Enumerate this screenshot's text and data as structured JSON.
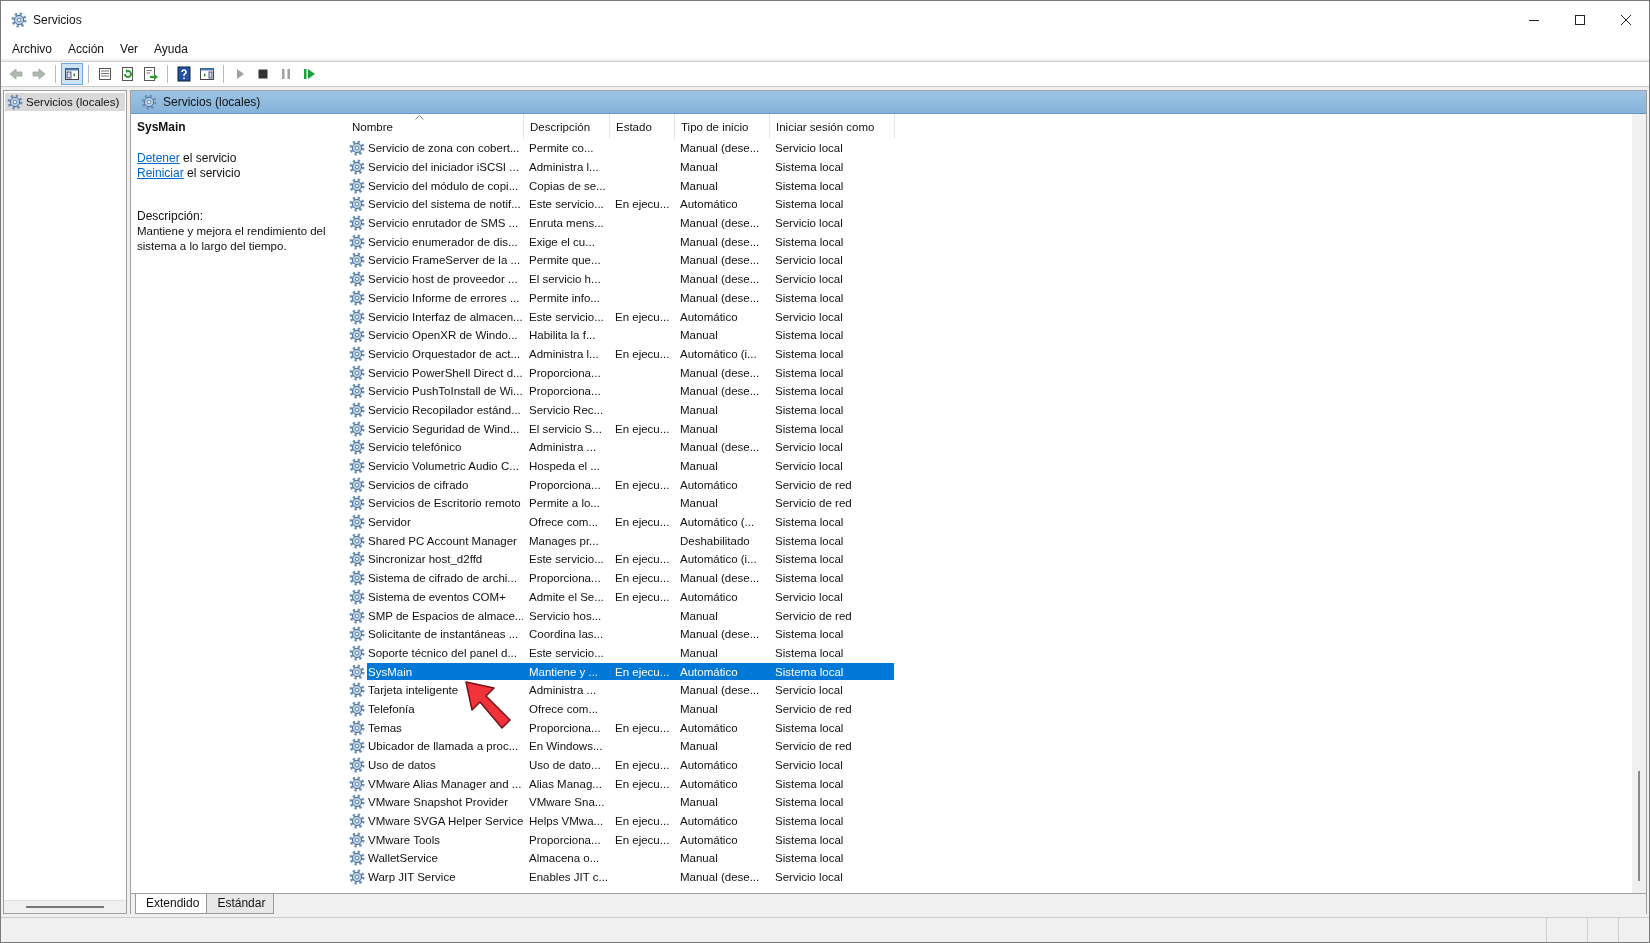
{
  "window": {
    "title": "Servicios"
  },
  "menu": [
    {
      "label": "Archivo"
    },
    {
      "label": "Acción"
    },
    {
      "label": "Ver"
    },
    {
      "label": "Ayuda"
    }
  ],
  "toolbar": [
    {
      "buttons": [
        {
          "kind": "back",
          "disabled": true,
          "pressed": false
        },
        {
          "kind": "forward",
          "disabled": true,
          "pressed": false
        }
      ]
    },
    {
      "buttons": [
        {
          "kind": "console_tree",
          "disabled": false,
          "pressed": true
        }
      ]
    },
    {
      "buttons": [
        {
          "kind": "properties",
          "disabled": false,
          "pressed": false
        },
        {
          "kind": "refresh",
          "disabled": false,
          "pressed": false
        },
        {
          "kind": "export",
          "disabled": false,
          "pressed": false
        }
      ]
    },
    {
      "buttons": [
        {
          "kind": "help",
          "disabled": false,
          "pressed": false
        },
        {
          "kind": "action_pane",
          "disabled": false,
          "pressed": false
        }
      ]
    },
    {
      "buttons": [
        {
          "kind": "start",
          "disabled": true,
          "pressed": false
        },
        {
          "kind": "stop",
          "disabled": false,
          "pressed": false
        },
        {
          "kind": "pause",
          "disabled": true,
          "pressed": false
        },
        {
          "kind": "resume",
          "disabled": false,
          "pressed": false
        }
      ]
    }
  ],
  "tree": {
    "items": [
      {
        "label": "Servicios (locales)",
        "selected": true
      }
    ]
  },
  "panel": {
    "title": "Servicios (locales)"
  },
  "details": {
    "service_name": "SysMain",
    "actions": [
      {
        "link": "Detener",
        "text": " el servicio"
      },
      {
        "link": "Reiniciar",
        "text": " el servicio"
      }
    ],
    "description_label": "Descripción:",
    "description": "Mantiene y mejora el rendimiento del sistema a lo largo del tiempo."
  },
  "table": {
    "columns": [
      {
        "label": "Nombre",
        "sorted": true
      },
      {
        "label": "Descripción",
        "sorted": false
      },
      {
        "label": "Estado",
        "sorted": false
      },
      {
        "label": "Tipo de inicio",
        "sorted": false
      },
      {
        "label": "Iniciar sesión como",
        "sorted": false
      }
    ],
    "rows": [
      {
        "name": "Servicio de zona con cobert...",
        "description": "Permite co...",
        "startup": "Manual (dese...",
        "logon": "Servicio local",
        "selected": false
      },
      {
        "name": "Servicio del iniciador iSCSI ...",
        "description": "Administra l...",
        "startup": "Manual",
        "logon": "Sistema local",
        "selected": false
      },
      {
        "name": "Servicio del módulo de copi...",
        "description": "Copias de se...",
        "startup": "Manual",
        "logon": "Sistema local",
        "selected": false
      },
      {
        "name": "Servicio del sistema de notif...",
        "description": "Este servicio...",
        "status": "En ejecu...",
        "startup": "Automático",
        "logon": "Sistema local",
        "selected": false
      },
      {
        "name": "Servicio enrutador de SMS ...",
        "description": "Enruta mens...",
        "startup": "Manual (dese...",
        "logon": "Servicio local",
        "selected": false
      },
      {
        "name": "Servicio enumerador de dis...",
        "description": "Exige el cu...",
        "startup": "Manual (dese...",
        "logon": "Sistema local",
        "selected": false
      },
      {
        "name": "Servicio FrameServer de la ...",
        "description": "Permite que...",
        "startup": "Manual (dese...",
        "logon": "Servicio local",
        "selected": false
      },
      {
        "name": "Servicio host de proveedor ...",
        "description": "El servicio h...",
        "startup": "Manual (dese...",
        "logon": "Servicio local",
        "selected": false
      },
      {
        "name": "Servicio Informe de errores ...",
        "description": "Permite info...",
        "startup": "Manual (dese...",
        "logon": "Sistema local",
        "selected": false
      },
      {
        "name": "Servicio Interfaz de almacen...",
        "description": "Este servicio...",
        "status": "En ejecu...",
        "startup": "Automático",
        "logon": "Servicio local",
        "selected": false
      },
      {
        "name": "Servicio OpenXR de Windo...",
        "description": "Habilita la f...",
        "startup": "Manual",
        "logon": "Sistema local",
        "selected": false
      },
      {
        "name": "Servicio Orquestador de act...",
        "description": "Administra l...",
        "status": "En ejecu...",
        "startup": "Automático (i...",
        "logon": "Sistema local",
        "selected": false
      },
      {
        "name": "Servicio PowerShell Direct d...",
        "description": "Proporciona...",
        "startup": "Manual (dese...",
        "logon": "Sistema local",
        "selected": false
      },
      {
        "name": "Servicio PushToInstall de Wi...",
        "description": "Proporciona...",
        "startup": "Manual (dese...",
        "logon": "Sistema local",
        "selected": false
      },
      {
        "name": "Servicio Recopilador estánd...",
        "description": "Servicio Rec...",
        "startup": "Manual",
        "logon": "Sistema local",
        "selected": false
      },
      {
        "name": "Servicio Seguridad de Wind...",
        "description": "El servicio S...",
        "status": "En ejecu...",
        "startup": "Manual",
        "logon": "Sistema local",
        "selected": false
      },
      {
        "name": "Servicio telefónico",
        "description": "Administra ...",
        "startup": "Manual (dese...",
        "logon": "Servicio local",
        "selected": false
      },
      {
        "name": "Servicio Volumetric Audio C...",
        "description": "Hospeda el ...",
        "startup": "Manual",
        "logon": "Servicio local",
        "selected": false
      },
      {
        "name": "Servicios de cifrado",
        "description": "Proporciona...",
        "status": "En ejecu...",
        "startup": "Automático",
        "logon": "Servicio de red",
        "selected": false
      },
      {
        "name": "Servicios de Escritorio remoto",
        "description": "Permite a lo...",
        "startup": "Manual",
        "logon": "Servicio de red",
        "selected": false
      },
      {
        "name": "Servidor",
        "description": "Ofrece com...",
        "status": "En ejecu...",
        "startup": "Automático (...",
        "logon": "Sistema local",
        "selected": false
      },
      {
        "name": "Shared PC Account Manager",
        "description": "Manages pr...",
        "startup": "Deshabilitado",
        "logon": "Sistema local",
        "selected": false
      },
      {
        "name": "Sincronizar host_d2ffd",
        "description": "Este servicio...",
        "status": "En ejecu...",
        "startup": "Automático (i...",
        "logon": "Sistema local",
        "selected": false
      },
      {
        "name": "Sistema de cifrado de archi...",
        "description": "Proporciona...",
        "status": "En ejecu...",
        "startup": "Manual (dese...",
        "logon": "Sistema local",
        "selected": false
      },
      {
        "name": "Sistema de eventos COM+",
        "description": "Admite el Se...",
        "status": "En ejecu...",
        "startup": "Automático",
        "logon": "Servicio local",
        "selected": false
      },
      {
        "name": "SMP de Espacios de almace...",
        "description": "Servicio hos...",
        "startup": "Manual",
        "logon": "Servicio de red",
        "selected": false
      },
      {
        "name": "Solicitante de instantáneas ...",
        "description": "Coordina las...",
        "startup": "Manual (dese...",
        "logon": "Sistema local",
        "selected": false
      },
      {
        "name": "Soporte técnico del panel d...",
        "description": "Este servicio...",
        "startup": "Manual",
        "logon": "Sistema local",
        "selected": false
      },
      {
        "name": "SysMain",
        "description": "Mantiene y ...",
        "status": "En ejecu...",
        "startup": "Automático",
        "logon": "Sistema local",
        "selected": true
      },
      {
        "name": "Tarjeta inteligente",
        "description": "Administra ...",
        "startup": "Manual (dese...",
        "logon": "Servicio local",
        "selected": false
      },
      {
        "name": "Telefonía",
        "description": "Ofrece com...",
        "startup": "Manual",
        "logon": "Servicio de red",
        "selected": false
      },
      {
        "name": "Temas",
        "description": "Proporciona...",
        "status": "En ejecu...",
        "startup": "Automático",
        "logon": "Sistema local",
        "selected": false
      },
      {
        "name": "Ubicador de llamada a proc...",
        "description": "En Windows...",
        "startup": "Manual",
        "logon": "Servicio de red",
        "selected": false
      },
      {
        "name": "Uso de datos",
        "description": "Uso de dato...",
        "status": "En ejecu...",
        "startup": "Automático",
        "logon": "Servicio local",
        "selected": false
      },
      {
        "name": "VMware Alias Manager and ...",
        "description": "Alias Manag...",
        "status": "En ejecu...",
        "startup": "Automático",
        "logon": "Sistema local",
        "selected": false
      },
      {
        "name": "VMware Snapshot Provider",
        "description": "VMware Sna...",
        "startup": "Manual",
        "logon": "Sistema local",
        "selected": false
      },
      {
        "name": "VMware SVGA Helper Service",
        "description": "Helps VMwa...",
        "status": "En ejecu...",
        "startup": "Automático",
        "logon": "Sistema local",
        "selected": false
      },
      {
        "name": "VMware Tools",
        "description": "Proporciona...",
        "status": "En ejecu...",
        "startup": "Automático",
        "logon": "Sistema local",
        "selected": false
      },
      {
        "name": "WalletService",
        "description": "Almacena o...",
        "startup": "Manual",
        "logon": "Sistema local",
        "selected": false
      },
      {
        "name": "Warp JIT Service",
        "description": "Enables JIT c...",
        "startup": "Manual (dese...",
        "logon": "Servicio local",
        "selected": false
      }
    ]
  },
  "view_tabs": [
    {
      "label": "Extendido",
      "selected": true
    },
    {
      "label": "Estándar",
      "selected": false
    }
  ]
}
